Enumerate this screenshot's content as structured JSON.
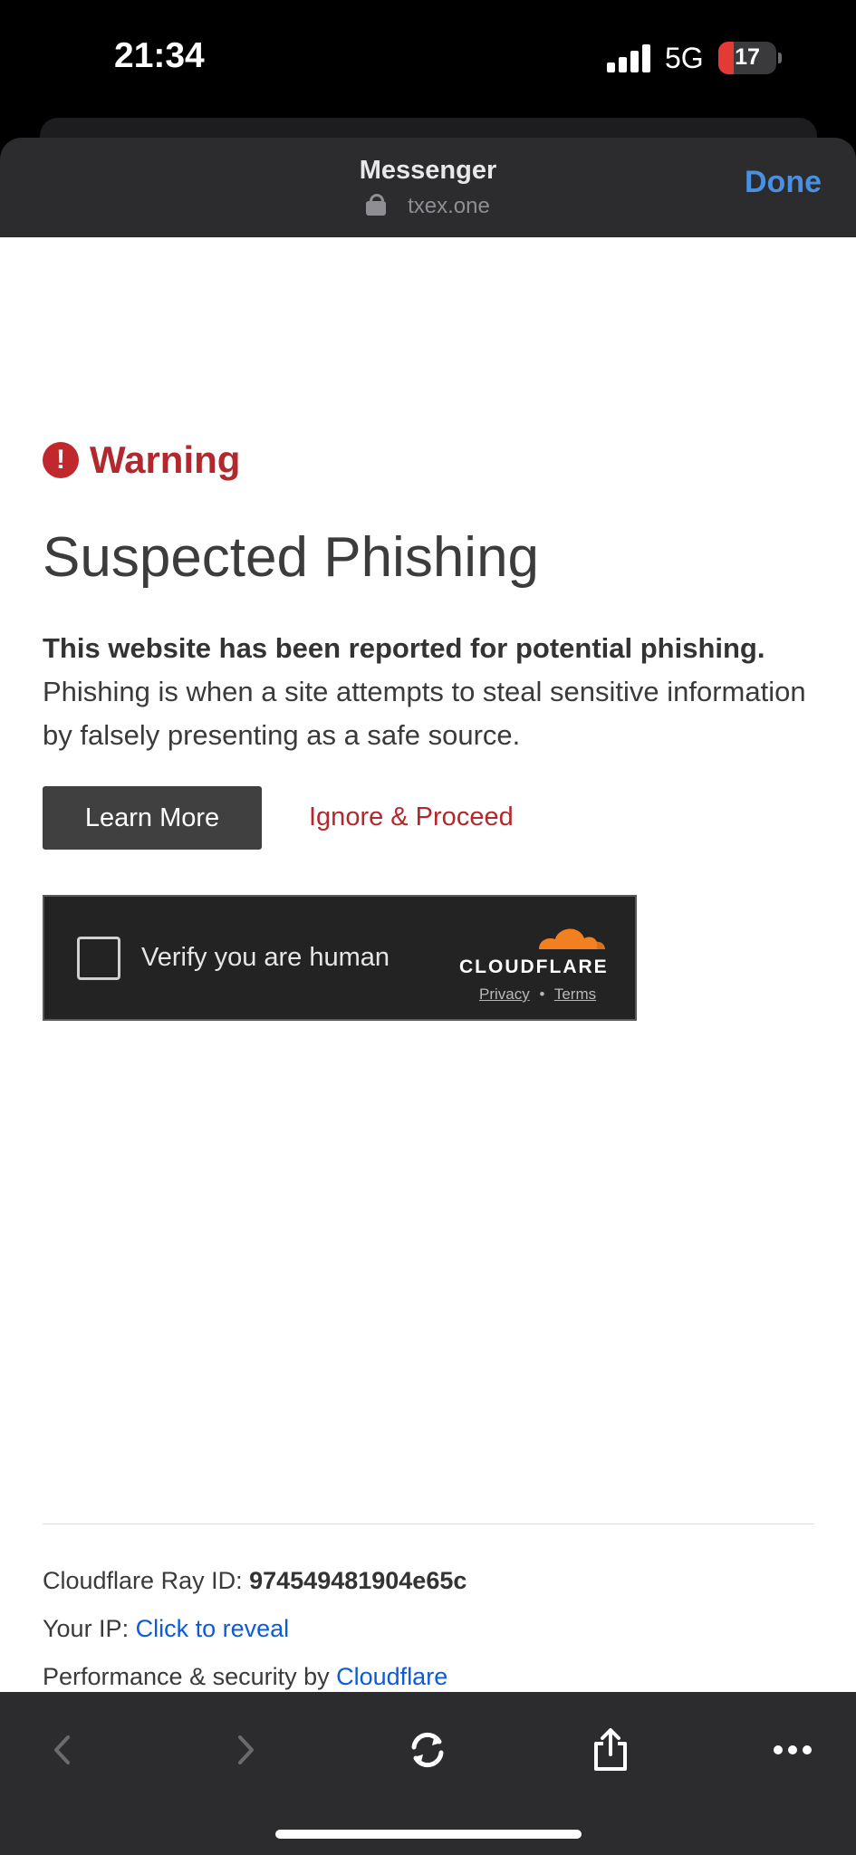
{
  "status_bar": {
    "time": "21:34",
    "network": "5G",
    "battery": "17",
    "battery_level": 0.17
  },
  "header": {
    "title": "Messenger",
    "url": "txex.one",
    "done_label": "Done"
  },
  "warning": {
    "label": "Warning",
    "heading": "Suspected Phishing",
    "bold_text": "This website has been reported for potential phishing.",
    "body_text": "Phishing is when a site attempts to steal sensitive information by falsely presenting as a safe source.",
    "learn_more": "Learn More",
    "ignore": "Ignore & Proceed"
  },
  "turnstile": {
    "label": "Verify you are human",
    "brand": "CLOUDFLARE",
    "privacy": "Privacy",
    "separator": "•",
    "terms": "Terms",
    "brand_color": "#f38020"
  },
  "footer": {
    "ray_label": "Cloudflare Ray ID:",
    "ray_id": "974549481904e65c",
    "ip_label": "Your IP:",
    "ip_link": "Click to reveal",
    "perf_label": "Performance & security by",
    "perf_link": "Cloudflare"
  },
  "toolbar": {
    "icons": [
      "chevron-left-icon",
      "chevron-right-icon",
      "reload-icon",
      "share-icon",
      "more-icon"
    ]
  }
}
